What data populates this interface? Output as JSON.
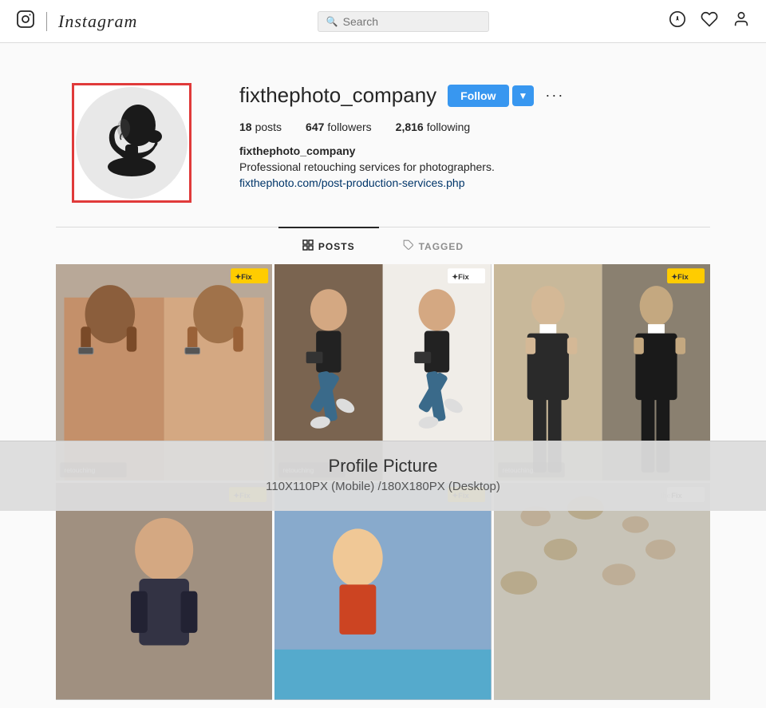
{
  "navbar": {
    "logo_icon": "⬜",
    "brand": "Instagram",
    "search_placeholder": "Search",
    "compass_icon": "⊘",
    "heart_icon": "♡",
    "user_icon": "👤"
  },
  "profile": {
    "username": "fixthephoto_company",
    "follow_label": "Follow",
    "dropdown_label": "▼",
    "more_label": "···",
    "stats": {
      "posts_count": "18",
      "posts_label": "posts",
      "followers_count": "647",
      "followers_label": "followers",
      "following_count": "2,816",
      "following_label": "following"
    },
    "display_name": "fixthephoto_company",
    "bio": "Professional retouching services for photographers.",
    "link": "fixthephoto.com/post-production-services.php"
  },
  "tabs": [
    {
      "id": "posts",
      "label": "POSTS",
      "icon": "⊞",
      "active": true
    },
    {
      "id": "tagged",
      "label": "TAGGED",
      "icon": "🏷",
      "active": false
    }
  ],
  "bottom_overlay": {
    "title": "Profile Picture",
    "subtitle": "110X110PX (Mobile) /180X180PX (Desktop)"
  }
}
